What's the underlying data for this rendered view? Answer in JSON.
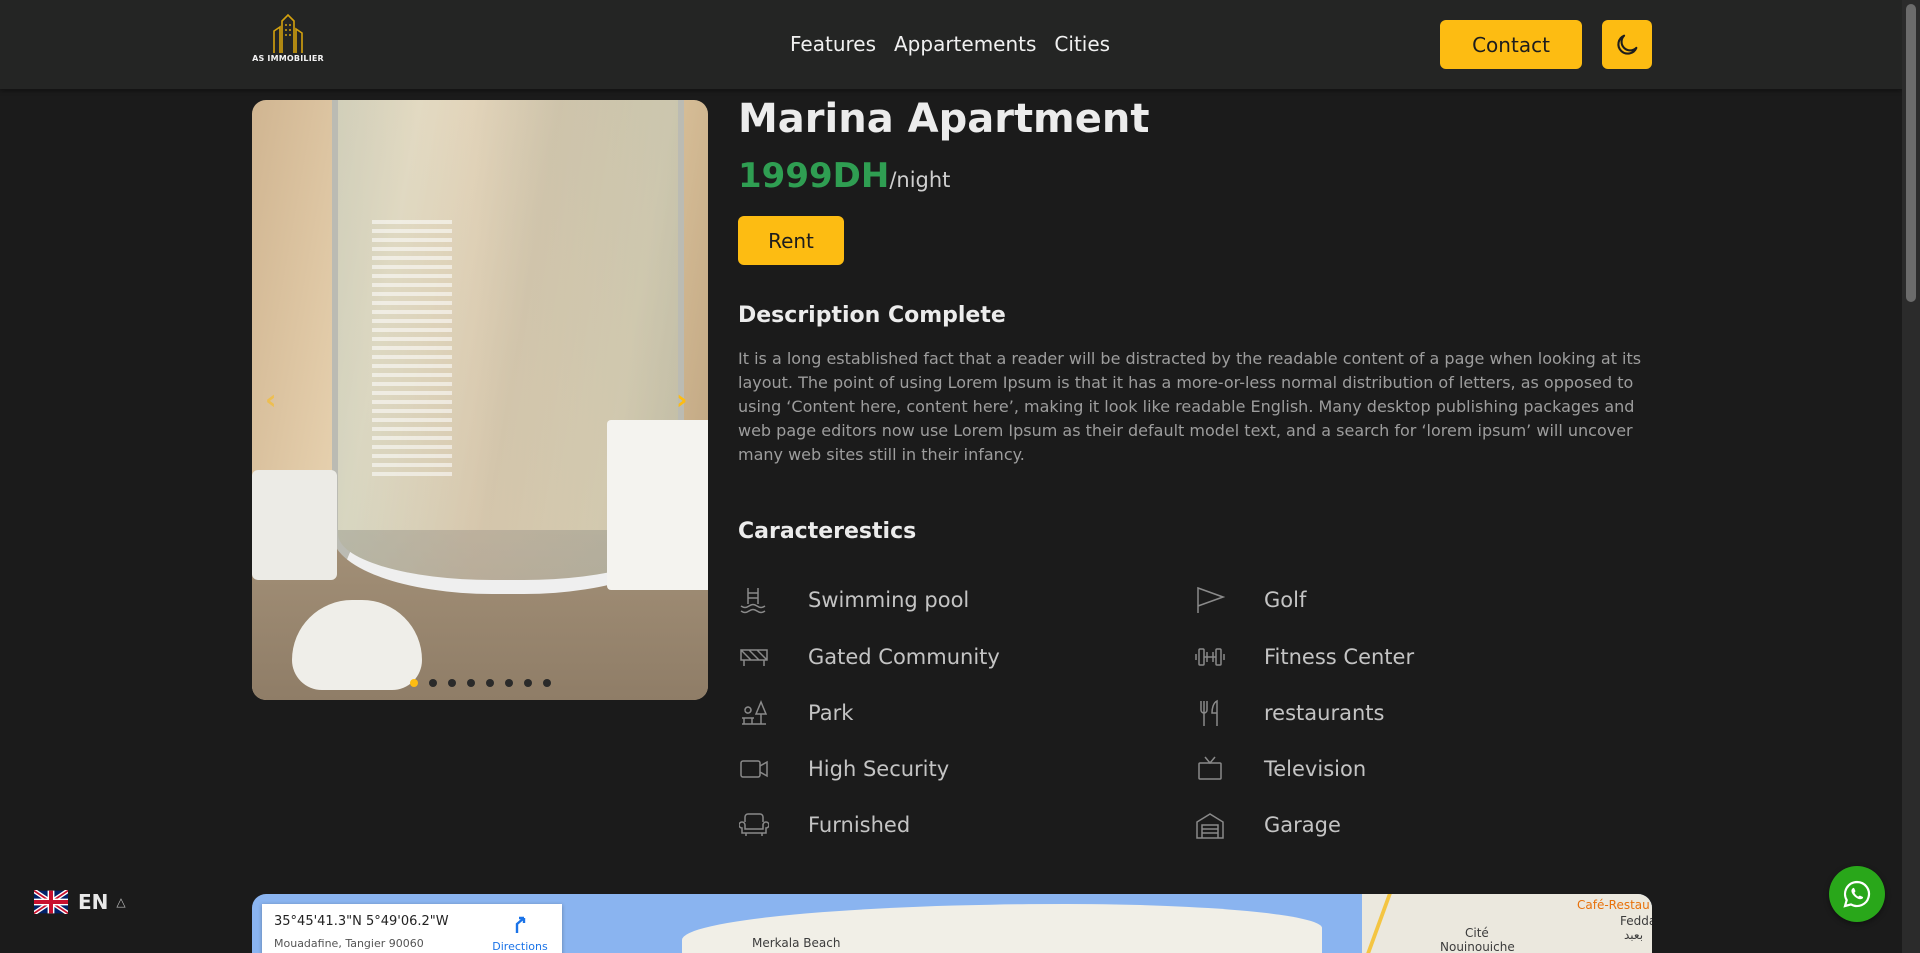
{
  "header": {
    "logo_text": "AS IMMOBILIER",
    "nav": [
      "Features",
      "Appartements",
      "Cities"
    ],
    "contact_label": "Contact",
    "theme_icon": "moon-icon"
  },
  "gallery": {
    "slide_count": 8,
    "active_slide": 1
  },
  "listing": {
    "title": "Marina Apartment",
    "price": "1999DH",
    "price_unit": "/night",
    "rent_label": "Rent",
    "description_heading": "Description Complete",
    "description": "It is a long established fact that a reader will be distracted by the readable content of a page when looking at its layout. The point of using Lorem Ipsum is that it has a more-or-less normal distribution of letters, as opposed to using ‘Content here, content here’, making it look like readable English. Many desktop publishing packages and web page editors now use Lorem Ipsum as their default model text, and a search for ‘lorem ipsum’ will uncover many web sites still in their infancy.",
    "characteristics_heading": "Caracterestics",
    "features": [
      {
        "label": "Swimming pool",
        "icon": "pool-ladder-icon"
      },
      {
        "label": "Golf",
        "icon": "flag-icon"
      },
      {
        "label": "Gated Community",
        "icon": "fence-icon"
      },
      {
        "label": "Fitness Center",
        "icon": "dumbbell-icon"
      },
      {
        "label": "Park",
        "icon": "park-icon"
      },
      {
        "label": "restaurants",
        "icon": "fork-knife-icon"
      },
      {
        "label": "High Security",
        "icon": "camera-icon"
      },
      {
        "label": "Television",
        "icon": "tv-icon"
      },
      {
        "label": "Furnished",
        "icon": "armchair-icon"
      },
      {
        "label": "Garage",
        "icon": "garage-icon"
      }
    ]
  },
  "map": {
    "coords": "35°45'41.3\"N 5°49'06.2\"W",
    "address": "Mouadafine, Tangier 90060",
    "directions_label": "Directions",
    "places": [
      "Merkala Beach",
      "Café-Restau",
      "Fedda",
      "Cité",
      "Nouinouiche",
      "بعبد"
    ]
  },
  "language": {
    "code": "EN",
    "flag_icon": "uk-flag-icon"
  },
  "colors": {
    "accent": "#fdbc12",
    "price": "#2f9e52",
    "background": "#1b1b1b",
    "header": "#242524",
    "whatsapp": "#29a71a"
  }
}
